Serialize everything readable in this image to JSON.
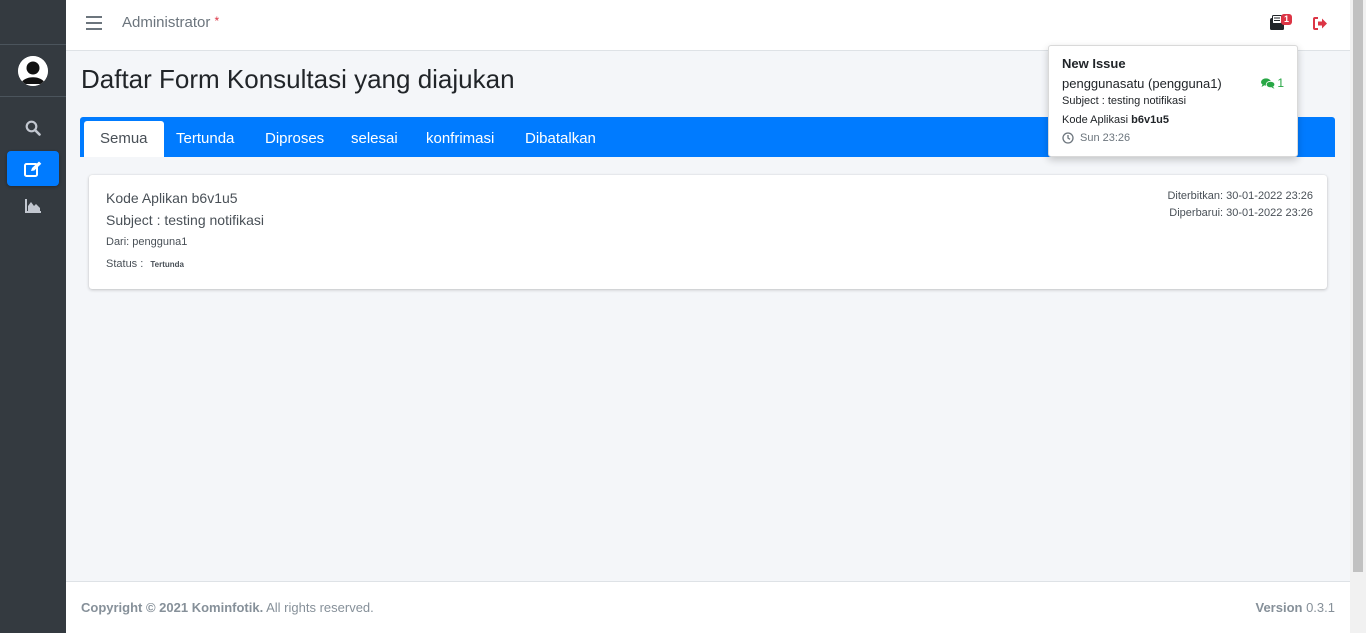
{
  "navbar": {
    "user_label": "Administrator",
    "user_marker": "*",
    "notification_count": "1"
  },
  "sidebar": {
    "items": [
      {
        "icon": "search-icon"
      },
      {
        "icon": "edit-icon",
        "active": true
      },
      {
        "icon": "chart-area-icon"
      }
    ]
  },
  "page": {
    "title": "Daftar Form Konsultasi yang diajukan"
  },
  "tabs": [
    {
      "label": "Semua",
      "active": true
    },
    {
      "label": "Tertunda"
    },
    {
      "label": "Diproses"
    },
    {
      "label": "selesai"
    },
    {
      "label": "konfrimasi"
    },
    {
      "label": "Dibatalkan"
    }
  ],
  "card": {
    "kode": "Kode Aplikan b6v1u5",
    "subject": "Subject : testing notifikasi",
    "dari": "Dari: pengguna1",
    "status_label": "Status :",
    "status_value": "Tertunda",
    "diterbitkan": "Diterbitkan: 30-01-2022 23:26",
    "diperbarui": "Diperbarui: 30-01-2022 23:26"
  },
  "dropdown": {
    "title": "New Issue",
    "user": "penggunasatu (pengguna1)",
    "comment_count": "1",
    "subject": "Subject : testing notifikasi",
    "kode_prefix": "Kode Aplikasi",
    "kode_value": "b6v1u5",
    "time": "Sun 23:26"
  },
  "footer": {
    "copyright_bold": "Copyright © 2021 Kominfotik.",
    "copyright_rest": "All rights reserved.",
    "version_label": "Version",
    "version_value": "0.3.1"
  },
  "colors": {
    "primary": "#007bff",
    "sidebar": "#343a40",
    "danger": "#dc3545",
    "success": "#28a745"
  }
}
